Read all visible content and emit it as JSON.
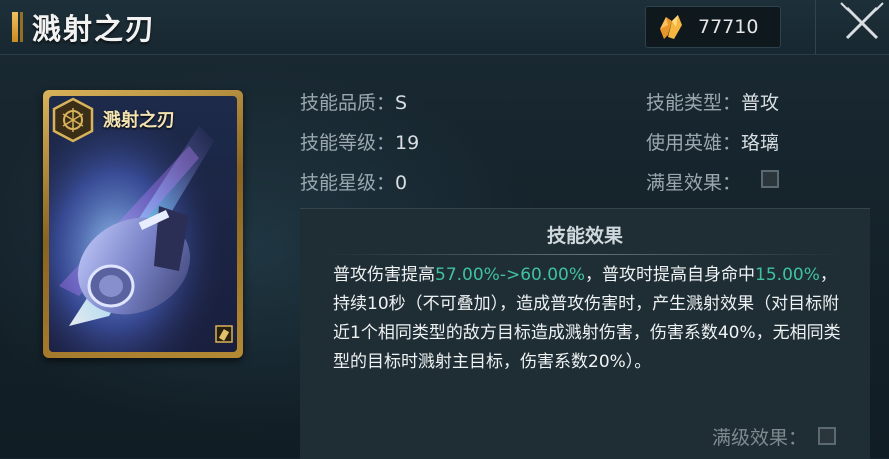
{
  "header": {
    "title": "溅射之刃",
    "currency_icon": "orange-crystal-icon",
    "currency_value": "77710",
    "close_icon": "close-icon"
  },
  "card": {
    "name": "溅射之刃",
    "emblem_icon": "hexagon-wheel-icon",
    "corner_icon": "bullet-icon"
  },
  "stats": {
    "quality_label": "技能品质：",
    "quality_value": "S",
    "level_label": "技能等级：",
    "level_value": "19",
    "star_label": "技能星级：",
    "star_value": "0",
    "type_label": "技能类型：",
    "type_value": "普攻",
    "hero_label": "使用英雄：",
    "hero_value": "珞璃",
    "fullstar_label": "满星效果："
  },
  "effect": {
    "title": "技能效果",
    "seg1": "普攻伤害提高",
    "hl1": "57.00%->60.00%",
    "seg2": "，普攻时提高自身命中",
    "hl2": "15.00%",
    "seg3": "，持续10秒（不可叠加），造成普攻伤害时，产生溅射效果（对目标附近1个相同类型的敌方目标造成溅射伤害，伤害系数40%，无相同类型的目标时溅射主目标，伤害系数20%）。",
    "maxlevel_label": "满级效果："
  },
  "colors": {
    "highlight": "#3fc2a0",
    "gold": "#d9b35a",
    "background": "#16252d"
  }
}
